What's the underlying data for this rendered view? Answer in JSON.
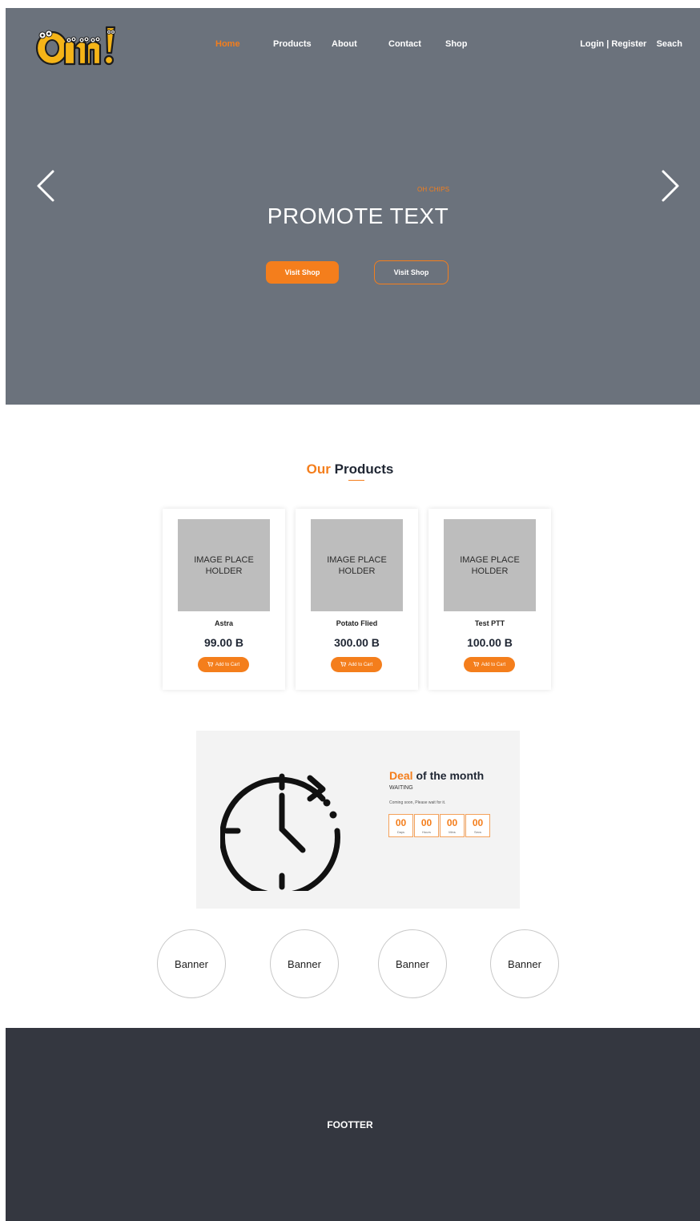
{
  "header": {
    "logo_alt": "Omn!",
    "nav": [
      {
        "label": "Home",
        "active": true
      },
      {
        "label": "Products",
        "active": false
      },
      {
        "label": "About",
        "active": false
      },
      {
        "label": "Contact",
        "active": false
      },
      {
        "label": "Shop",
        "active": false
      }
    ],
    "login_register": "Login | Register",
    "search": "Seach"
  },
  "hero": {
    "subtitle": "OH CHIPS",
    "title": "PROMOTE TEXT",
    "primary_button": "Visit Shop",
    "secondary_button": "Visit Shop",
    "prev_icon": "chevron-left-icon",
    "next_icon": "chevron-right-icon"
  },
  "products_section": {
    "title_accent": "Our",
    "title_rest": "Products",
    "items": [
      {
        "image_text": "IMAGE PLACE HOLDER",
        "name": "Astra",
        "price": "99.00 B",
        "button": "Add to Cart"
      },
      {
        "image_text": "IMAGE PLACE HOLDER",
        "name": "Potato Flied",
        "price": "300.00 B",
        "button": "Add to Cart"
      },
      {
        "image_text": "IMAGE PLACE HOLDER",
        "name": "Test PTT",
        "price": "100.00 B",
        "button": "Add to Cart"
      }
    ]
  },
  "deal": {
    "title_accent": "Deal",
    "title_rest": "of the month",
    "status": "WAITING",
    "note": "Coming soon, Please wait for it.",
    "countdown": [
      {
        "value": "00",
        "label": "Days"
      },
      {
        "value": "00",
        "label": "Hours"
      },
      {
        "value": "00",
        "label": "Mins"
      },
      {
        "value": "00",
        "label": "Secs"
      }
    ]
  },
  "banners": [
    "Banner",
    "Banner",
    "Banner",
    "Banner"
  ],
  "footer": {
    "text": "FOOTTER"
  },
  "colors": {
    "accent": "#f47e1c",
    "hero_bg": "#6b727c",
    "footer_bg": "#343740"
  }
}
